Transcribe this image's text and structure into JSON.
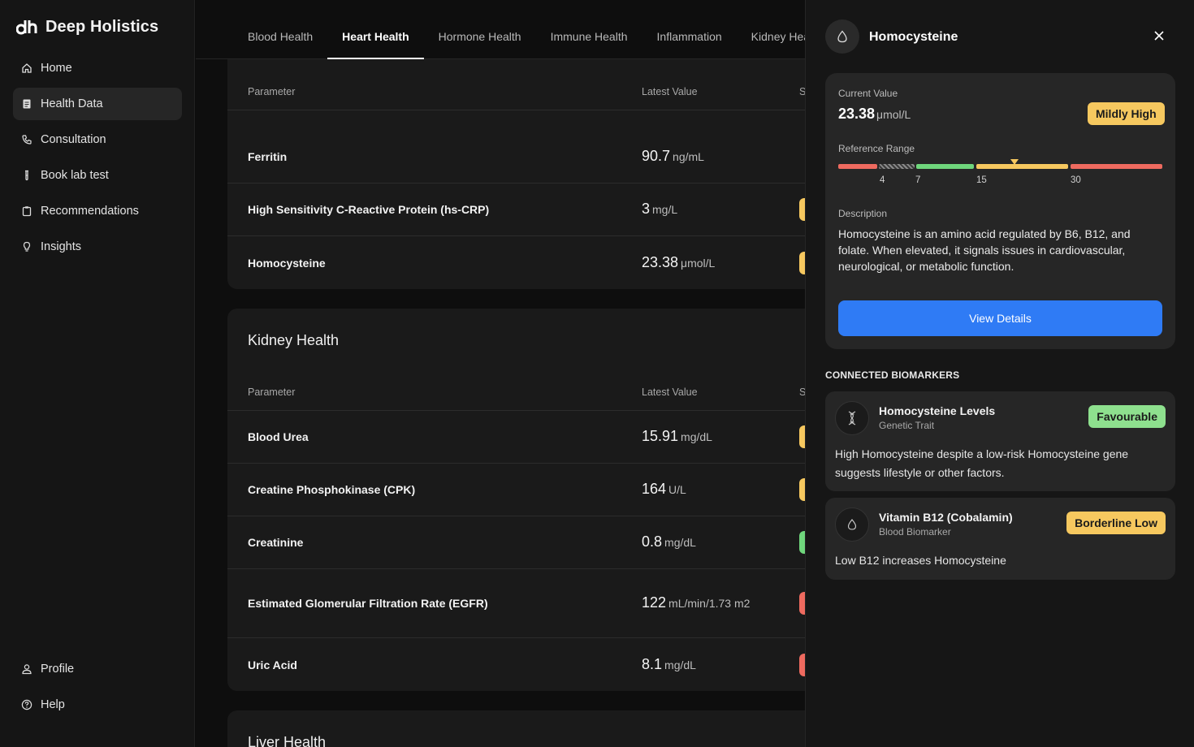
{
  "brand": {
    "name": "Deep Holistics"
  },
  "nav": {
    "items": [
      {
        "label": "Home"
      },
      {
        "label": "Health Data"
      },
      {
        "label": "Consultation"
      },
      {
        "label": "Book lab test"
      },
      {
        "label": "Recommendations"
      },
      {
        "label": "Insights"
      }
    ],
    "bottom": [
      {
        "label": "Profile"
      },
      {
        "label": "Help"
      }
    ]
  },
  "tabs": [
    "Blood Health",
    "Heart Health",
    "Hormone Health",
    "Immune Health",
    "Inflammation",
    "Kidney Health"
  ],
  "active_tab": "Heart Health",
  "ghost_heading": "Inflammation",
  "table_headers": {
    "parameter": "Parameter",
    "latest_value": "Latest Value",
    "status": "S"
  },
  "inflammation": {
    "rows": [
      {
        "param": "Ferritin",
        "value": "90.7",
        "unit": "ng/mL",
        "status_color": ""
      },
      {
        "param": "High Sensitivity C-Reactive Protein (hs-CRP)",
        "value": "3",
        "unit": "mg/L",
        "status_color": "#f6c85f"
      },
      {
        "param": "Homocysteine",
        "value": "23.38",
        "unit": "μmol/L",
        "status_color": "#f6c85f"
      }
    ]
  },
  "kidney": {
    "title": "Kidney Health",
    "rows": [
      {
        "param": "Blood Urea",
        "value": "15.91",
        "unit": "mg/dL",
        "status_color": "#f6c85f"
      },
      {
        "param": "Creatine Phosphokinase (CPK)",
        "value": "164",
        "unit": "U/L",
        "status_color": "#f6c85f"
      },
      {
        "param": "Creatinine",
        "value": "0.8",
        "unit": "mg/dL",
        "status_color": "#6fd67c"
      },
      {
        "param": "Estimated Glomerular Filtration Rate (EGFR)",
        "value": "122",
        "unit": "mL/min/1.73 m2",
        "status_color": "#ee6a5f"
      },
      {
        "param": "Uric Acid",
        "value": "8.1",
        "unit": "mg/dL",
        "status_color": "#ee6a5f"
      }
    ]
  },
  "liver": {
    "title": "Liver Health"
  },
  "panel": {
    "title": "Homocysteine",
    "current_value_label": "Current Value",
    "current_value": "23.38",
    "current_unit": "μmol/L",
    "status": "Mildly High",
    "reference_range_label": "Reference Range",
    "range_ticks": [
      "4",
      "7",
      "15",
      "30"
    ],
    "current_marker_value": 23.38,
    "description_label": "Description",
    "description": "Homocysteine is an amino acid regulated by B6, B12, and folate. When elevated, it signals issues in cardiovascular, neurological, or metabolic function.",
    "button": "View Details",
    "connected_label": "CONNECTED BIOMARKERS",
    "biomarkers": [
      {
        "name": "Homocysteine Levels",
        "type": "Genetic Trait",
        "badge": "Favourable",
        "badge_color": "#8ee08e",
        "text": "High Homocysteine despite a low-risk Homocysteine gene suggests lifestyle or other factors.",
        "icon": "dna-icon"
      },
      {
        "name": "Vitamin B12 (Cobalamin)",
        "type": "Blood Biomarker",
        "badge": "Borderline Low",
        "badge_color": "#f6c85f",
        "text": "Low B12 increases Homocysteine",
        "icon": "drop-icon"
      }
    ]
  },
  "colors": {
    "red": "#ee6a5f",
    "green": "#6fd67c",
    "yellow": "#f6c85f",
    "blue": "#2f7bf5"
  }
}
